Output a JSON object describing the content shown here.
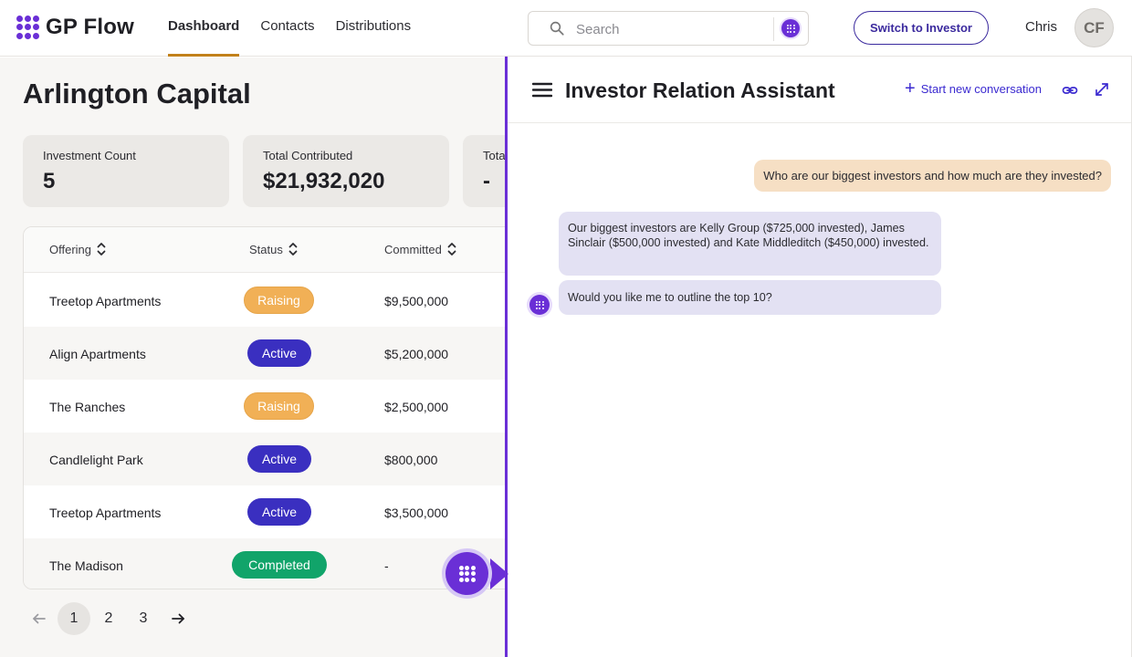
{
  "app": {
    "name": "GP Flow",
    "brand_color": "#6a2fd6",
    "accent_color": "#c2811a"
  },
  "nav": {
    "items": [
      {
        "label": "Dashboard",
        "active": true
      },
      {
        "label": "Contacts",
        "active": false
      },
      {
        "label": "Distributions",
        "active": false
      }
    ]
  },
  "search": {
    "placeholder": "Search",
    "value": ""
  },
  "header": {
    "switch_label": "Switch to Investor",
    "user_name": "Chris",
    "avatar_initials": "CF"
  },
  "dashboard": {
    "title": "Arlington Capital",
    "cards": [
      {
        "label": "Investment Count",
        "value": "5"
      },
      {
        "label": "Total Contributed",
        "value": "$21,932,020"
      },
      {
        "label": "Tota",
        "value": "-"
      }
    ],
    "table": {
      "columns": [
        "Offering",
        "Status",
        "Committed"
      ],
      "rows": [
        {
          "offering": "Treetop Apartments",
          "status": "Raising",
          "committed": "$9,500,000"
        },
        {
          "offering": "Align Apartments",
          "status": "Active",
          "committed": "$5,200,000"
        },
        {
          "offering": "The Ranches",
          "status": "Raising",
          "committed": "$2,500,000"
        },
        {
          "offering": "Candlelight Park",
          "status": "Active",
          "committed": "$800,000"
        },
        {
          "offering": "Treetop Apartments",
          "status": "Active",
          "committed": "$3,500,000"
        },
        {
          "offering": "The Madison",
          "status": "Completed",
          "committed": "-"
        }
      ]
    },
    "pagination": {
      "pages": [
        "1",
        "2",
        "3"
      ],
      "current": "1"
    }
  },
  "assistant": {
    "title": "Investor Relation Assistant",
    "new_conversation_label": "Start new conversation",
    "messages": [
      {
        "role": "user",
        "text": "Who are our biggest investors and how much are they invested?"
      },
      {
        "role": "assistant",
        "text": "Our biggest investors are Kelly Group ($725,000 invested), James Sinclair ($500,000 invested) and Kate Middleditch ($450,000) invested."
      },
      {
        "role": "assistant",
        "text": "Would you like me to outline the top 10?"
      }
    ]
  },
  "status_colors": {
    "Raising": "#f1b056",
    "Active": "#3a2fc0",
    "Completed": "#11a46a"
  }
}
